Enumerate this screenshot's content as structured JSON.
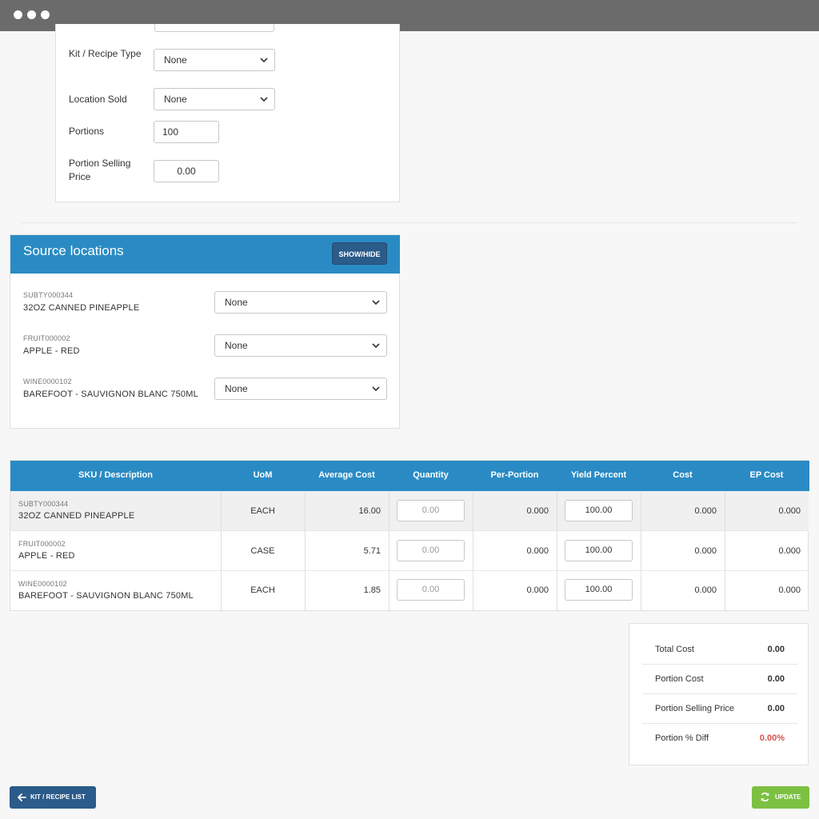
{
  "form": {
    "kit_type_label": "Kit / Recipe Type",
    "kit_type_value": "None",
    "location_sold_label": "Location Sold",
    "location_sold_value": "None",
    "portions_label": "Portions",
    "portions_value": "100",
    "portion_selling_price_label": "Portion Selling Price",
    "portion_selling_price_value": "0.00"
  },
  "source_locations": {
    "title": "Source locations",
    "toggle_label": "SHOW/HIDE",
    "items": [
      {
        "sku": "SUBTY000344",
        "description": "32OZ CANNED PINEAPPLE",
        "location": "None"
      },
      {
        "sku": "FRUIT000002",
        "description": "APPLE - RED",
        "location": "None"
      },
      {
        "sku": "WINE0000102",
        "description": "BAREFOOT - SAUVIGNON BLANC 750ML",
        "location": "None"
      }
    ]
  },
  "table": {
    "headers": [
      "SKU / Description",
      "UoM",
      "Average Cost",
      "Quantity",
      "Per-Portion",
      "Yield Percent",
      "Cost",
      "EP Cost"
    ],
    "rows": [
      {
        "sku": "SUBTY000344",
        "description": "32OZ CANNED PINEAPPLE",
        "uom": "EACH",
        "average_cost": "16.00",
        "quantity": "0.00",
        "per_portion": "0.000",
        "yield_percent": "100.00",
        "cost": "0.000",
        "ep_cost": "0.000"
      },
      {
        "sku": "FRUIT000002",
        "description": "APPLE - RED",
        "uom": "CASE",
        "average_cost": "5.71",
        "quantity": "0.00",
        "per_portion": "0.000",
        "yield_percent": "100.00",
        "cost": "0.000",
        "ep_cost": "0.000"
      },
      {
        "sku": "WINE0000102",
        "description": "BAREFOOT - SAUVIGNON BLANC 750ML",
        "uom": "EACH",
        "average_cost": "1.85",
        "quantity": "0.00",
        "per_portion": "0.000",
        "yield_percent": "100.00",
        "cost": "0.000",
        "ep_cost": "0.000"
      }
    ]
  },
  "summary": {
    "total_cost_label": "Total Cost",
    "total_cost_value": "0.00",
    "portion_cost_label": "Portion Cost",
    "portion_cost_value": "0.00",
    "portion_selling_price_label": "Portion Selling Price",
    "portion_selling_price_value": "0.00",
    "portion_diff_label": "Portion % Diff",
    "portion_diff_value": "0.00%"
  },
  "buttons": {
    "back_label": "KIT / RECIPE LIST",
    "back_icon": "arrow-left-icon",
    "update_label": "UPDATE",
    "update_icon": "refresh-icon"
  },
  "colors": {
    "header_blue": "#2a8bc4",
    "button_navy": "#2b5b8a",
    "update_green": "#7cc142",
    "diff_red": "#d9534f"
  }
}
